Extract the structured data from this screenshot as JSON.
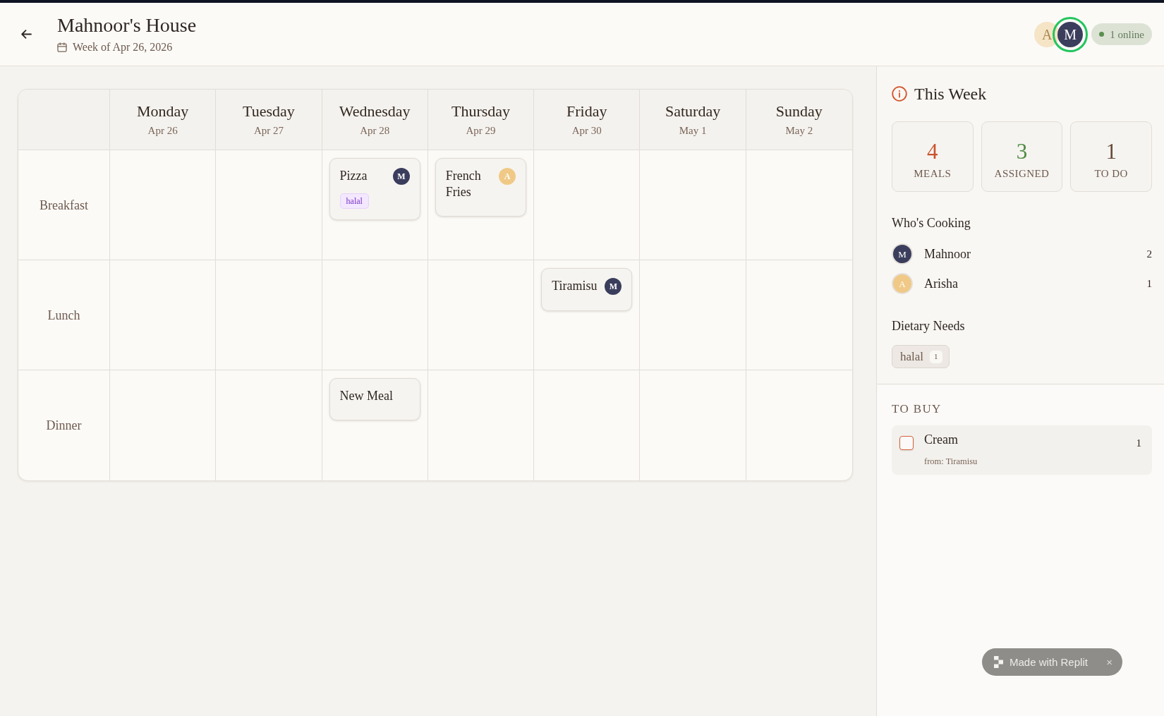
{
  "header": {
    "title": "Mahnoor's House",
    "week": "Week of Apr 26, 2026",
    "avatars": [
      {
        "initial": "A",
        "color": "#f5e4c6",
        "online": false
      },
      {
        "initial": "M",
        "color": "#3a3d5c",
        "online": true
      }
    ],
    "presence": "1 online"
  },
  "planner": {
    "days": [
      {
        "name": "Monday",
        "date": "Apr 26"
      },
      {
        "name": "Tuesday",
        "date": "Apr 27"
      },
      {
        "name": "Wednesday",
        "date": "Apr 28"
      },
      {
        "name": "Thursday",
        "date": "Apr 29"
      },
      {
        "name": "Friday",
        "date": "Apr 30"
      },
      {
        "name": "Saturday",
        "date": "May 1"
      },
      {
        "name": "Sunday",
        "date": "May 2"
      }
    ],
    "rows": [
      {
        "label": "Breakfast",
        "cells": [
          null,
          null,
          {
            "title": "Pizza",
            "cook": {
              "initial": "M",
              "color": "#3a3d5c"
            },
            "tags": [
              "halal"
            ]
          },
          {
            "title": "French Fries",
            "cook": {
              "initial": "A",
              "color": "#f0c987"
            }
          },
          null,
          null,
          null
        ]
      },
      {
        "label": "Lunch",
        "cells": [
          null,
          null,
          null,
          null,
          {
            "title": "Tiramisu",
            "cook": {
              "initial": "M",
              "color": "#3a3d5c"
            }
          },
          null,
          null
        ]
      },
      {
        "label": "Dinner",
        "cells": [
          null,
          null,
          {
            "title": "New Meal"
          },
          null,
          null,
          null,
          null
        ]
      }
    ]
  },
  "summary": {
    "title": "This Week",
    "stats": [
      {
        "value": "4",
        "label": "MEALS",
        "color": "#c9532e"
      },
      {
        "value": "3",
        "label": "ASSIGNED",
        "color": "#4e8a43"
      },
      {
        "value": "1",
        "label": "TO DO",
        "color": "#6b4a3a"
      }
    ]
  },
  "cooking": {
    "title": "Who's Cooking",
    "people": [
      {
        "initial": "M",
        "name": "Mahnoor",
        "count": "2",
        "color": "#3a3d5c"
      },
      {
        "initial": "A",
        "name": "Arisha",
        "count": "1",
        "color": "#f0c987"
      }
    ]
  },
  "dietary": {
    "title": "Dietary Needs",
    "tags": [
      {
        "label": "halal",
        "count": "1"
      }
    ]
  },
  "to_buy": {
    "title": "TO BUY",
    "items": [
      {
        "name": "Cream",
        "source": "from: Tiramisu",
        "count": "1",
        "checked": false
      }
    ]
  },
  "badge": {
    "label": "Made with Replit",
    "close": "×"
  }
}
